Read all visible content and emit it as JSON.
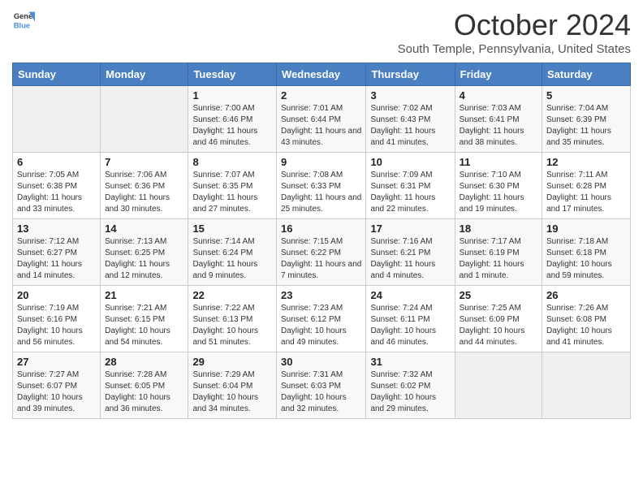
{
  "header": {
    "logo_general": "General",
    "logo_blue": "Blue",
    "month_title": "October 2024",
    "location": "South Temple, Pennsylvania, United States"
  },
  "days_of_week": [
    "Sunday",
    "Monday",
    "Tuesday",
    "Wednesday",
    "Thursday",
    "Friday",
    "Saturday"
  ],
  "weeks": [
    [
      {
        "day": "",
        "sunrise": "",
        "sunset": "",
        "daylight": ""
      },
      {
        "day": "",
        "sunrise": "",
        "sunset": "",
        "daylight": ""
      },
      {
        "day": "1",
        "sunrise": "Sunrise: 7:00 AM",
        "sunset": "Sunset: 6:46 PM",
        "daylight": "Daylight: 11 hours and 46 minutes."
      },
      {
        "day": "2",
        "sunrise": "Sunrise: 7:01 AM",
        "sunset": "Sunset: 6:44 PM",
        "daylight": "Daylight: 11 hours and 43 minutes."
      },
      {
        "day": "3",
        "sunrise": "Sunrise: 7:02 AM",
        "sunset": "Sunset: 6:43 PM",
        "daylight": "Daylight: 11 hours and 41 minutes."
      },
      {
        "day": "4",
        "sunrise": "Sunrise: 7:03 AM",
        "sunset": "Sunset: 6:41 PM",
        "daylight": "Daylight: 11 hours and 38 minutes."
      },
      {
        "day": "5",
        "sunrise": "Sunrise: 7:04 AM",
        "sunset": "Sunset: 6:39 PM",
        "daylight": "Daylight: 11 hours and 35 minutes."
      }
    ],
    [
      {
        "day": "6",
        "sunrise": "Sunrise: 7:05 AM",
        "sunset": "Sunset: 6:38 PM",
        "daylight": "Daylight: 11 hours and 33 minutes."
      },
      {
        "day": "7",
        "sunrise": "Sunrise: 7:06 AM",
        "sunset": "Sunset: 6:36 PM",
        "daylight": "Daylight: 11 hours and 30 minutes."
      },
      {
        "day": "8",
        "sunrise": "Sunrise: 7:07 AM",
        "sunset": "Sunset: 6:35 PM",
        "daylight": "Daylight: 11 hours and 27 minutes."
      },
      {
        "day": "9",
        "sunrise": "Sunrise: 7:08 AM",
        "sunset": "Sunset: 6:33 PM",
        "daylight": "Daylight: 11 hours and 25 minutes."
      },
      {
        "day": "10",
        "sunrise": "Sunrise: 7:09 AM",
        "sunset": "Sunset: 6:31 PM",
        "daylight": "Daylight: 11 hours and 22 minutes."
      },
      {
        "day": "11",
        "sunrise": "Sunrise: 7:10 AM",
        "sunset": "Sunset: 6:30 PM",
        "daylight": "Daylight: 11 hours and 19 minutes."
      },
      {
        "day": "12",
        "sunrise": "Sunrise: 7:11 AM",
        "sunset": "Sunset: 6:28 PM",
        "daylight": "Daylight: 11 hours and 17 minutes."
      }
    ],
    [
      {
        "day": "13",
        "sunrise": "Sunrise: 7:12 AM",
        "sunset": "Sunset: 6:27 PM",
        "daylight": "Daylight: 11 hours and 14 minutes."
      },
      {
        "day": "14",
        "sunrise": "Sunrise: 7:13 AM",
        "sunset": "Sunset: 6:25 PM",
        "daylight": "Daylight: 11 hours and 12 minutes."
      },
      {
        "day": "15",
        "sunrise": "Sunrise: 7:14 AM",
        "sunset": "Sunset: 6:24 PM",
        "daylight": "Daylight: 11 hours and 9 minutes."
      },
      {
        "day": "16",
        "sunrise": "Sunrise: 7:15 AM",
        "sunset": "Sunset: 6:22 PM",
        "daylight": "Daylight: 11 hours and 7 minutes."
      },
      {
        "day": "17",
        "sunrise": "Sunrise: 7:16 AM",
        "sunset": "Sunset: 6:21 PM",
        "daylight": "Daylight: 11 hours and 4 minutes."
      },
      {
        "day": "18",
        "sunrise": "Sunrise: 7:17 AM",
        "sunset": "Sunset: 6:19 PM",
        "daylight": "Daylight: 11 hours and 1 minute."
      },
      {
        "day": "19",
        "sunrise": "Sunrise: 7:18 AM",
        "sunset": "Sunset: 6:18 PM",
        "daylight": "Daylight: 10 hours and 59 minutes."
      }
    ],
    [
      {
        "day": "20",
        "sunrise": "Sunrise: 7:19 AM",
        "sunset": "Sunset: 6:16 PM",
        "daylight": "Daylight: 10 hours and 56 minutes."
      },
      {
        "day": "21",
        "sunrise": "Sunrise: 7:21 AM",
        "sunset": "Sunset: 6:15 PM",
        "daylight": "Daylight: 10 hours and 54 minutes."
      },
      {
        "day": "22",
        "sunrise": "Sunrise: 7:22 AM",
        "sunset": "Sunset: 6:13 PM",
        "daylight": "Daylight: 10 hours and 51 minutes."
      },
      {
        "day": "23",
        "sunrise": "Sunrise: 7:23 AM",
        "sunset": "Sunset: 6:12 PM",
        "daylight": "Daylight: 10 hours and 49 minutes."
      },
      {
        "day": "24",
        "sunrise": "Sunrise: 7:24 AM",
        "sunset": "Sunset: 6:11 PM",
        "daylight": "Daylight: 10 hours and 46 minutes."
      },
      {
        "day": "25",
        "sunrise": "Sunrise: 7:25 AM",
        "sunset": "Sunset: 6:09 PM",
        "daylight": "Daylight: 10 hours and 44 minutes."
      },
      {
        "day": "26",
        "sunrise": "Sunrise: 7:26 AM",
        "sunset": "Sunset: 6:08 PM",
        "daylight": "Daylight: 10 hours and 41 minutes."
      }
    ],
    [
      {
        "day": "27",
        "sunrise": "Sunrise: 7:27 AM",
        "sunset": "Sunset: 6:07 PM",
        "daylight": "Daylight: 10 hours and 39 minutes."
      },
      {
        "day": "28",
        "sunrise": "Sunrise: 7:28 AM",
        "sunset": "Sunset: 6:05 PM",
        "daylight": "Daylight: 10 hours and 36 minutes."
      },
      {
        "day": "29",
        "sunrise": "Sunrise: 7:29 AM",
        "sunset": "Sunset: 6:04 PM",
        "daylight": "Daylight: 10 hours and 34 minutes."
      },
      {
        "day": "30",
        "sunrise": "Sunrise: 7:31 AM",
        "sunset": "Sunset: 6:03 PM",
        "daylight": "Daylight: 10 hours and 32 minutes."
      },
      {
        "day": "31",
        "sunrise": "Sunrise: 7:32 AM",
        "sunset": "Sunset: 6:02 PM",
        "daylight": "Daylight: 10 hours and 29 minutes."
      },
      {
        "day": "",
        "sunrise": "",
        "sunset": "",
        "daylight": ""
      },
      {
        "day": "",
        "sunrise": "",
        "sunset": "",
        "daylight": ""
      }
    ]
  ]
}
